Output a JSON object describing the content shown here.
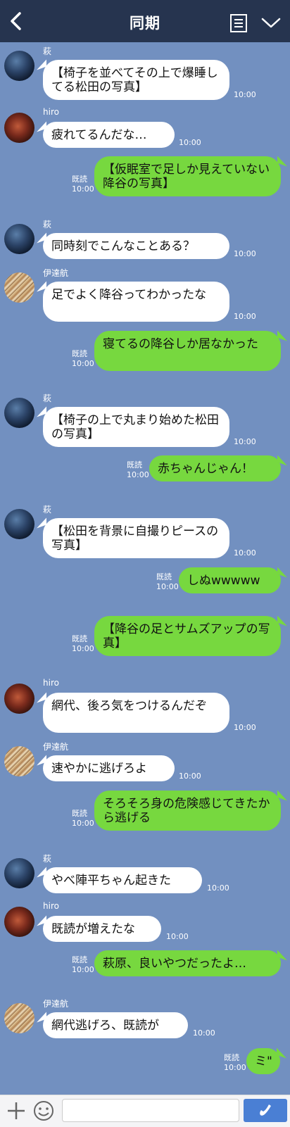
{
  "header": {
    "title": "同期"
  },
  "footer": {
    "input_value": "",
    "input_placeholder": ""
  },
  "messages": [
    {
      "side": "in",
      "sender": "萩",
      "avatar": "hagi",
      "text": "【椅子を並べてその上で爆睡してる松田の写真】",
      "time": "10:00"
    },
    {
      "side": "in",
      "sender": "hiro",
      "avatar": "hiro",
      "text": "疲れてるんだな…",
      "time": "10:00"
    },
    {
      "side": "out",
      "read": "既読",
      "text": "【仮眠室で足しか見えていない降谷の写真】",
      "time": "10:00"
    },
    {
      "side": "in",
      "sender": "萩",
      "avatar": "hagi",
      "text": "同時刻でこんなことある？",
      "time": "10:00"
    },
    {
      "side": "in",
      "sender": "伊達航",
      "avatar": "date",
      "text": "足でよく降谷ってわかったな",
      "time": "10:00"
    },
    {
      "side": "out",
      "read": "既読",
      "text": "寝てるの降谷しか居なかった",
      "time": "10:00"
    },
    {
      "side": "in",
      "sender": "萩",
      "avatar": "hagi",
      "text": "【椅子の上で丸まり始めた松田の写真】",
      "time": "10:00"
    },
    {
      "side": "out",
      "read": "既読",
      "text": "赤ちゃんじゃん！",
      "time": "10:00"
    },
    {
      "side": "in",
      "sender": "萩",
      "avatar": "hagi",
      "text": "【松田を背景に自撮りピースの写真】",
      "time": "10:00"
    },
    {
      "side": "out",
      "read": "既読",
      "text": "しぬwwwww",
      "time": "10:00"
    },
    {
      "side": "out",
      "read": "既読",
      "text": "【降谷の足とサムズアップの写真】",
      "time": "10:00"
    },
    {
      "side": "in",
      "sender": "hiro",
      "avatar": "hiro",
      "text": "網代、後ろ気をつけるんだぞ",
      "time": "10:00"
    },
    {
      "side": "in",
      "sender": "伊達航",
      "avatar": "date",
      "text": "速やかに逃げろよ",
      "time": "10:00"
    },
    {
      "side": "out",
      "read": "既読",
      "text": "そろそろ身の危険感じてきたから逃げる",
      "time": "10:00"
    },
    {
      "side": "in",
      "sender": "萩",
      "avatar": "hagi",
      "text": "やべ陣平ちゃん起きた",
      "time": "10:00"
    },
    {
      "side": "in",
      "sender": "hiro",
      "avatar": "hiro",
      "text": "既読が増えたな",
      "time": "10:00"
    },
    {
      "side": "out",
      "read": "既読",
      "text": "萩原、良いやつだったよ…",
      "time": "10:00"
    },
    {
      "side": "in",
      "sender": "伊達航",
      "avatar": "date",
      "text": "網代逃げろ、既読が",
      "time": "10:00"
    },
    {
      "side": "out",
      "read": "既読",
      "text": "ミ\"",
      "time": "10:00"
    }
  ]
}
